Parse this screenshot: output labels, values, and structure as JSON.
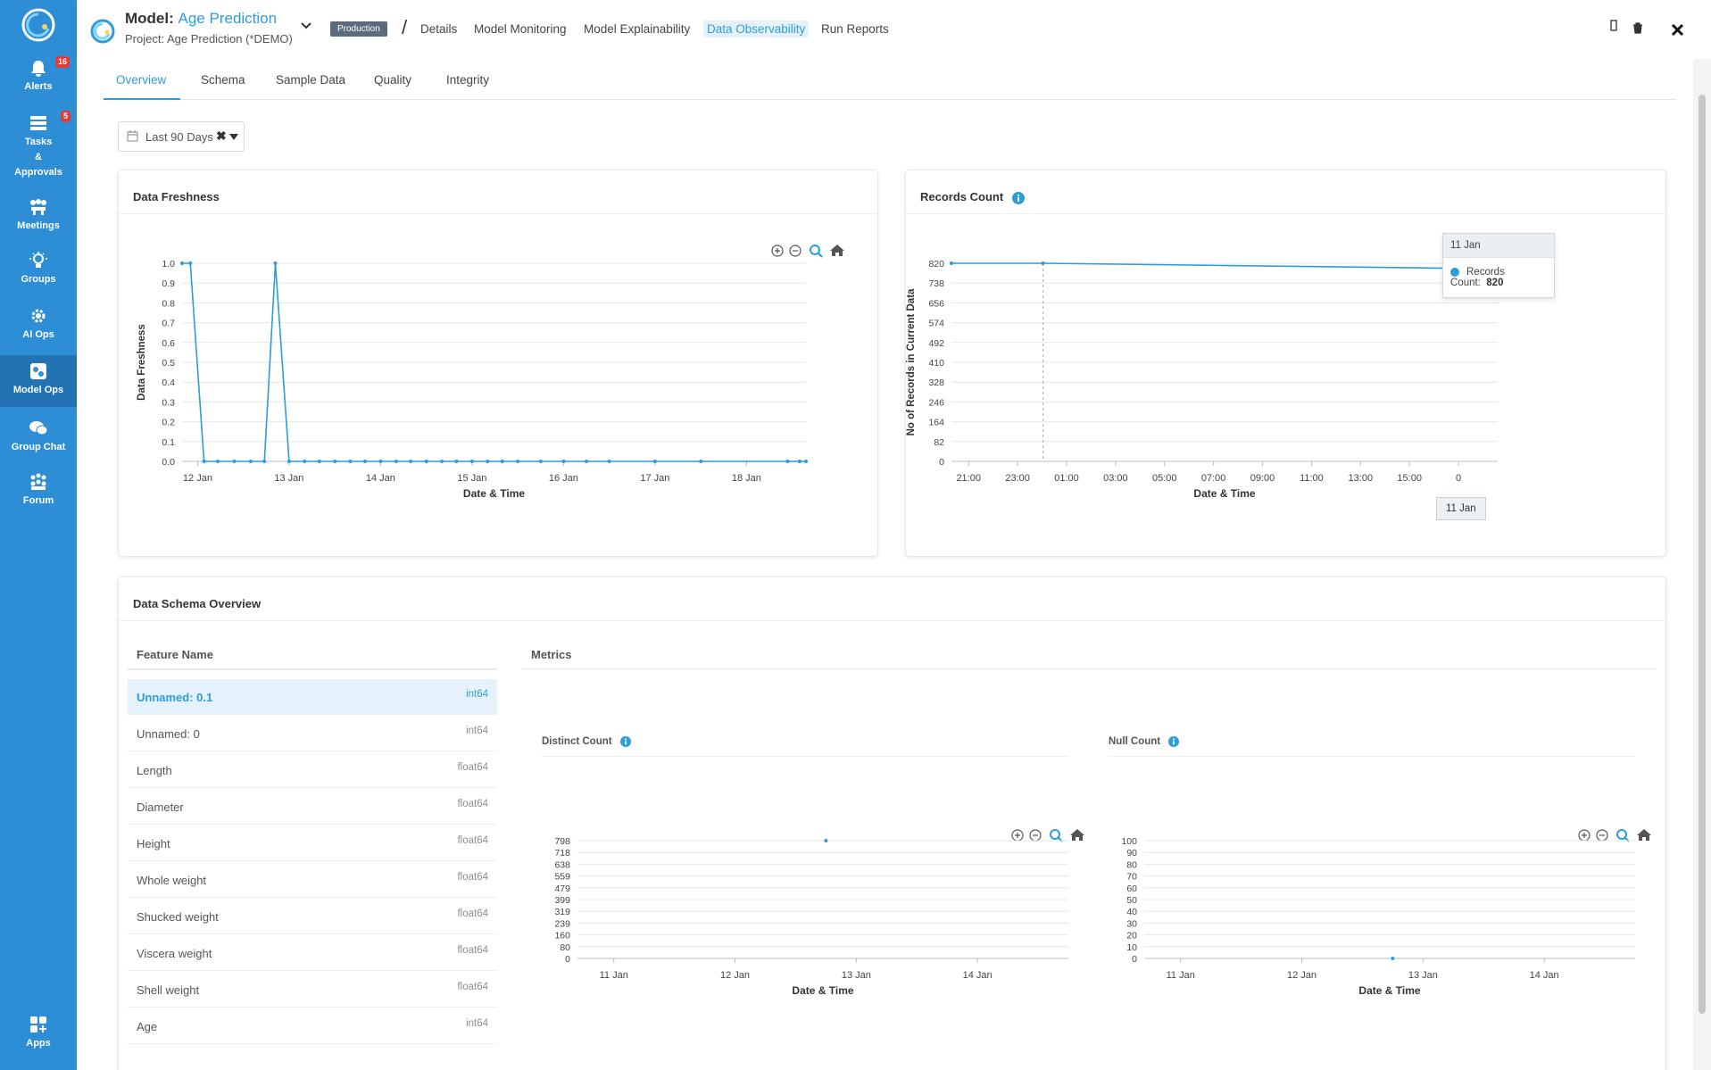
{
  "sidebar": {
    "items": [
      {
        "label": "Alerts",
        "badge": "16"
      },
      {
        "label": "Tasks & Approvals",
        "badge": "5"
      },
      {
        "label": "Meetings"
      },
      {
        "label": "Groups"
      },
      {
        "label": "AI Ops"
      },
      {
        "label": "Model Ops"
      },
      {
        "label": "Group Chat"
      },
      {
        "label": "Forum"
      },
      {
        "label": "Apps"
      }
    ],
    "tasks_line1": "Tasks",
    "tasks_line2": "&",
    "tasks_line3": "Approvals"
  },
  "header": {
    "model_prefix": "Model:",
    "model_name": "Age Prediction",
    "project": "Project: Age Prediction (*DEMO)",
    "status_badge": "Production",
    "nav": [
      "Details",
      "Model Monitoring",
      "Model Explainability",
      "Data Observability",
      "Run Reports"
    ]
  },
  "tabs": [
    "Overview",
    "Schema",
    "Sample Data",
    "Quality",
    "Integrity"
  ],
  "date_filter": {
    "value": "Last 90 Days"
  },
  "data_freshness": {
    "title": "Data Freshness",
    "chart_data": {
      "type": "line",
      "xlabel": "Date & Time",
      "ylabel": "Data Freshness",
      "yticks": [
        "0.0",
        "0.1",
        "0.2",
        "0.3",
        "0.4",
        "0.5",
        "0.6",
        "0.7",
        "0.8",
        "0.9",
        "1.0"
      ],
      "xticks": [
        "12 Jan",
        "13 Jan",
        "14 Jan",
        "15 Jan",
        "16 Jan",
        "17 Jan",
        "18 Jan"
      ],
      "ylim": [
        0,
        1
      ],
      "xlim": [
        -0.17,
        6.65
      ],
      "x": [
        -0.17,
        -0.08,
        0.07,
        0.22,
        0.4,
        0.58,
        0.73,
        0.85,
        1.0,
        1.17,
        1.33,
        1.5,
        1.67,
        1.83,
        2.0,
        2.17,
        2.33,
        2.5,
        2.67,
        2.83,
        3.0,
        3.17,
        3.33,
        3.5,
        3.75,
        4.0,
        4.25,
        4.5,
        5.0,
        5.5,
        6.45,
        6.58,
        6.65
      ],
      "values": [
        1,
        1,
        0,
        0,
        0,
        0,
        0,
        1,
        0,
        0,
        0,
        0,
        0,
        0,
        0,
        0,
        0,
        0,
        0,
        0,
        0,
        0,
        0,
        0,
        0,
        0,
        0,
        0,
        0,
        0,
        0,
        0,
        0
      ]
    }
  },
  "records_count": {
    "title": "Records Count",
    "chart_data": {
      "type": "line",
      "xlabel": "Date & Time",
      "ylabel": "No of Records in Current Data",
      "yticks": [
        "0",
        "82",
        "164",
        "246",
        "328",
        "410",
        "492",
        "574",
        "656",
        "738",
        "820"
      ],
      "xticks": [
        "21:00",
        "23:00",
        "01:00",
        "03:00",
        "05:00",
        "07:00",
        "09:00",
        "11:00",
        "13:00",
        "15:00",
        "0"
      ],
      "ylim": [
        0,
        820
      ],
      "xlim": [
        -0.35,
        10.8
      ],
      "x": [
        -0.35,
        1.52,
        10.8
      ],
      "values": [
        820,
        820,
        797
      ]
    },
    "tooltip": {
      "title": "11 Jan",
      "label": "Records Count:",
      "value": "820"
    },
    "x_cursor_label": "11 Jan"
  },
  "schema": {
    "title": "Data Schema Overview",
    "feature_header": "Feature Name",
    "metrics_header": "Metrics",
    "features": [
      {
        "name": "Unnamed: 0.1",
        "type": "int64"
      },
      {
        "name": "Unnamed: 0",
        "type": "int64"
      },
      {
        "name": "Length",
        "type": "float64"
      },
      {
        "name": "Diameter",
        "type": "float64"
      },
      {
        "name": "Height",
        "type": "float64"
      },
      {
        "name": "Whole weight",
        "type": "float64"
      },
      {
        "name": "Shucked weight",
        "type": "float64"
      },
      {
        "name": "Viscera weight",
        "type": "float64"
      },
      {
        "name": "Shell weight",
        "type": "float64"
      },
      {
        "name": "Age",
        "type": "int64"
      }
    ],
    "distinct_count": {
      "title": "Distinct Count",
      "chart_data": {
        "type": "scatter",
        "xlabel": "Date & Time",
        "yticks": [
          "0",
          "80",
          "160",
          "239",
          "319",
          "399",
          "479",
          "559",
          "638",
          "718",
          "798"
        ],
        "xticks": [
          "11 Jan",
          "12 Jan",
          "13 Jan",
          "14 Jan"
        ],
        "ylim": [
          0,
          798
        ],
        "xlim": [
          -0.3,
          3.75
        ],
        "x": [
          1.75
        ],
        "values": [
          798
        ]
      }
    },
    "null_count": {
      "title": "Null Count",
      "chart_data": {
        "type": "scatter",
        "xlabel": "Date & Time",
        "yticks": [
          "0",
          "10",
          "20",
          "30",
          "40",
          "50",
          "60",
          "70",
          "80",
          "90",
          "100"
        ],
        "xticks": [
          "11 Jan",
          "12 Jan",
          "13 Jan",
          "14 Jan"
        ],
        "ylim": [
          0,
          100
        ],
        "xlim": [
          -0.3,
          3.75
        ],
        "x": [
          1.75
        ],
        "values": [
          0
        ]
      }
    }
  },
  "colors": {
    "accent": "#2d9cdb",
    "sidebar": "#2d8ed6",
    "badge": "#e53935"
  }
}
